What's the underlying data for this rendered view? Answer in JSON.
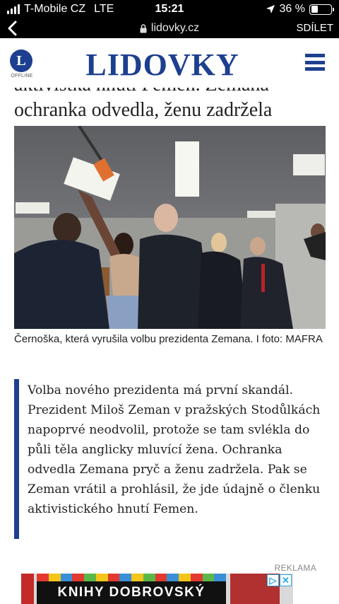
{
  "status_bar": {
    "carrier": "T-Mobile CZ",
    "network": "LTE",
    "time": "15:21",
    "battery_percent_text": "36 %",
    "battery_level": 0.36
  },
  "browser": {
    "url": "lidovky.cz",
    "share_label": "SDÍLET"
  },
  "site": {
    "logo_letter": "L",
    "offline_label": "OFFLINE",
    "brand": "LIDOVKY"
  },
  "article": {
    "headline_prev_line": "aktivistka hnutí Femen. Zemana",
    "headline_line": "ochranka odvedla, ženu zadržela",
    "photo_caption": "Černoška, která vyrušila volbu prezidenta Zemana. I foto: MAFRA",
    "lead": "Volba nového prezidenta má první skandál. Prezident Miloš Zeman v pražských Stodůlkách napoprvé neodvolil, protože se tam svlékla do půli těla anglicky mluvící žena. Ochranka odvedla Zemana pryč a ženu zadržela. Pak se Zeman vrátil a prohlásil, že jde údajně o členku aktivistického hnutí Femen."
  },
  "ad": {
    "label": "REKLAMA",
    "banner_text": "KNIHY DOBROVSKÝ"
  },
  "colors": {
    "brand_blue": "#1d3f8f"
  }
}
